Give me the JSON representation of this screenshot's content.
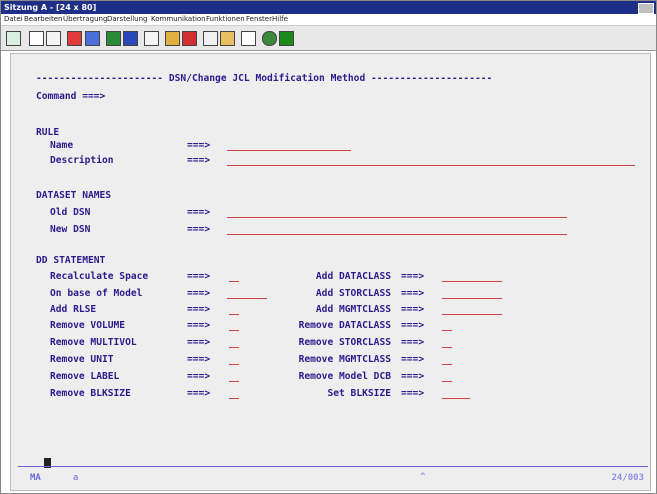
{
  "window": {
    "title": "Sitzung A - [24 x 80]"
  },
  "menu": [
    "Datei",
    "Bearbeiten",
    "Übertragung",
    "Darstellung",
    "Kommunikation",
    "Funktionen",
    "Fenster",
    "Hilfe"
  ],
  "screen": {
    "header": "---------------------- DSN/Change JCL Modification Method ---------------------",
    "command_label": "Command ===>",
    "rule": {
      "title": "RULE",
      "name_label": "Name",
      "description_label": "Description"
    },
    "datasets": {
      "title": "DATASET NAMES",
      "old_label": "Old DSN",
      "new_label": "New DSN"
    },
    "dd": {
      "title": "DD STATEMENT",
      "left": [
        "Recalculate Space",
        "On base of Model",
        "Add RLSE",
        "Remove VOLUME",
        "Remove MULTIVOL",
        "Remove UNIT",
        "Remove LABEL",
        "Remove BLKSIZE"
      ],
      "right": [
        "Add DATACLASS",
        "Add STORCLASS",
        "Add MGMTCLASS",
        "Remove DATACLASS",
        "Remove STORCLASS",
        "Remove MGMTCLASS",
        "Remove Model DCB",
        "Set BLKSIZE"
      ]
    },
    "arrow": "===>"
  },
  "status": {
    "mode": "MA",
    "session": "a",
    "position": "24/003"
  }
}
